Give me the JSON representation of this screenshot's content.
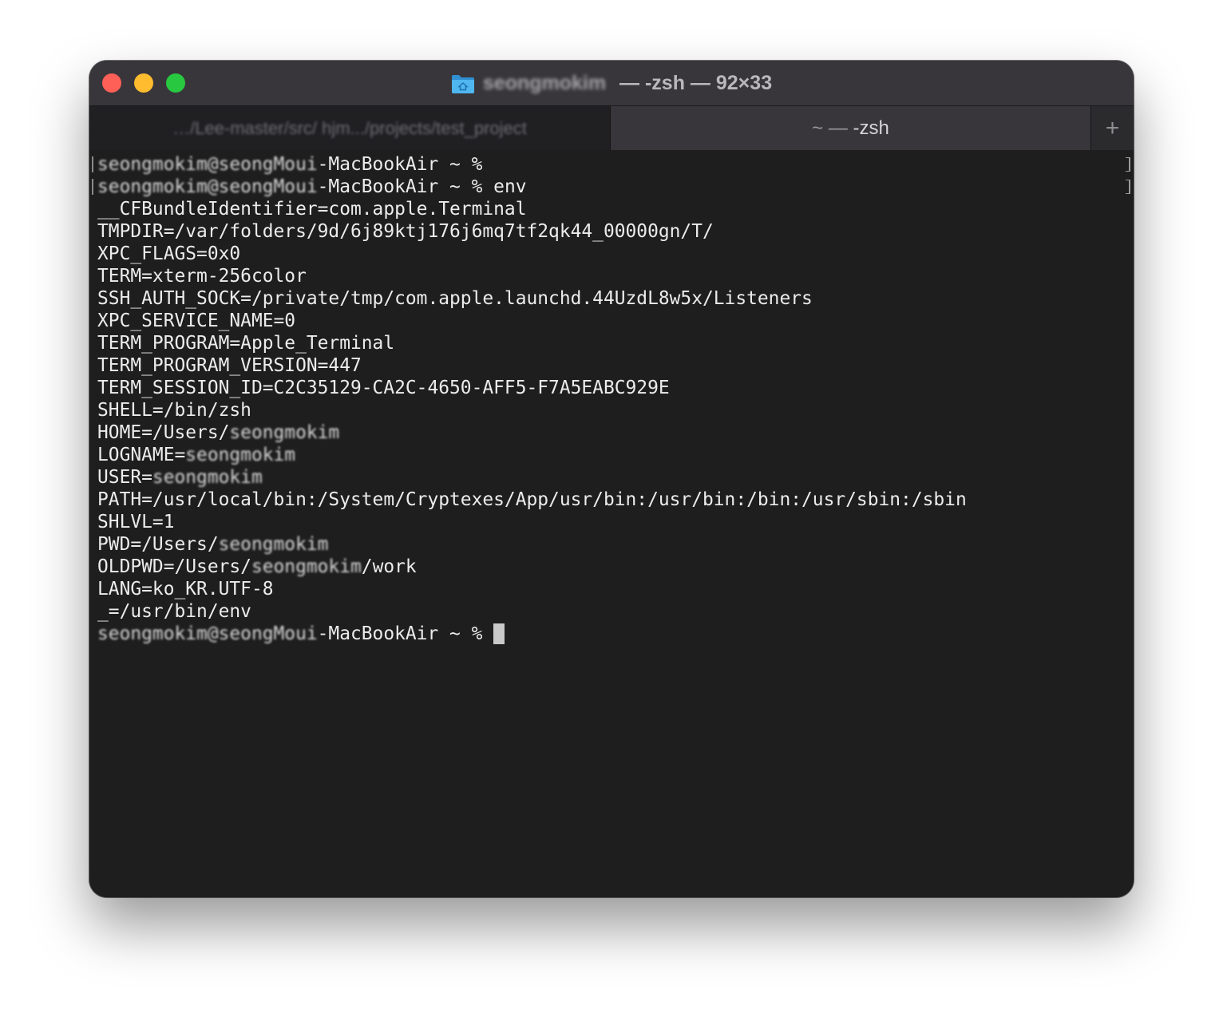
{
  "window": {
    "title_user": "seongmokim",
    "title_rest": " — -zsh — 92×33",
    "icon": "folder-home-icon"
  },
  "tabs": [
    {
      "label": "…/Lee-master/src/ hjm.../projects/test_project",
      "active": false
    },
    {
      "label_prefix": "~ — ",
      "label_main": "-zsh",
      "active": true
    }
  ],
  "new_tab_symbol": "+",
  "terminal": {
    "prompt_user": "seongmokim@seongMoui",
    "prompt_host": "-MacBookAir ~ % ",
    "command": "env",
    "env": [
      "__CFBundleIdentifier=com.apple.Terminal",
      "TMPDIR=/var/folders/9d/6j89ktj176j6mq7tf2qk44_00000gn/T/",
      "XPC_FLAGS=0x0",
      "TERM=xterm-256color",
      "SSH_AUTH_SOCK=/private/tmp/com.apple.launchd.44UzdL8w5x/Listeners",
      "XPC_SERVICE_NAME=0",
      "TERM_PROGRAM=Apple_Terminal",
      "TERM_PROGRAM_VERSION=447",
      "TERM_SESSION_ID=C2C35129-CA2C-4650-AFF5-F7A5EABC929E",
      "SHELL=/bin/zsh"
    ],
    "home_key": "HOME=/Users/",
    "home_user": "seongmokim",
    "logname_key": "LOGNAME=",
    "logname_user": "seongmokim",
    "user_key": "USER=",
    "user_user": "seongmokim",
    "path": "PATH=/usr/local/bin:/System/Cryptexes/App/usr/bin:/usr/bin:/bin:/usr/sbin:/sbin",
    "shlvl": "SHLVL=1",
    "pwd_key": "PWD=/Users/",
    "pwd_user": "seongmokim",
    "oldpwd_key": "OLDPWD=/Users/",
    "oldpwd_user": "seongmokim",
    "oldpwd_tail": "/work",
    "lang": "LANG=ko_KR.UTF-8",
    "underscore": "_=/usr/bin/env"
  },
  "colors": {
    "titlebar": "#38363b",
    "terminal_bg": "#1e1e1e",
    "text": "#ececec",
    "close": "#fe5f57",
    "minimize": "#febc2e",
    "zoom": "#28c840",
    "folder": "#3aa8e8"
  }
}
